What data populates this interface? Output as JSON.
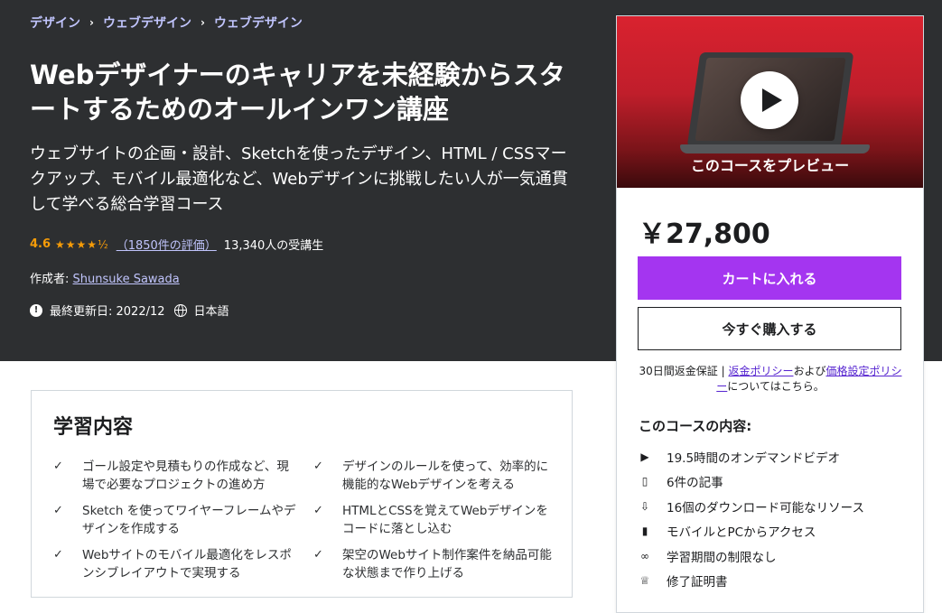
{
  "breadcrumb": [
    "デザイン",
    "ウェブデザイン",
    "ウェブデザイン"
  ],
  "course": {
    "title": "Webデザイナーのキャリアを未経験からスタートするためのオールインワン講座",
    "subtitle": "ウェブサイトの企画・設計、Sketchを使ったデザイン、HTML / CSSマークアップ、モバイル最適化など、Webデザインに挑戦したい人が一気通貫して学べる総合学習コース",
    "rating": "4.6",
    "rating_count": "（1850件の評価）",
    "students": "13,340人の受講生",
    "creator_label": "作成者: ",
    "creator": "Shunsuke Sawada",
    "updated": "最終更新日: 2022/12",
    "language": "日本語"
  },
  "sidebar": {
    "preview_label": "このコースをプレビュー",
    "price": "￥27,800",
    "cart_button": "カートに入れる",
    "buy_button": "今すぐ購入する",
    "guarantee_prefix": "30日間返金保証 | ",
    "refund_policy": "返金ポリシー",
    "and": "および",
    "pricing_policy": "価格設定ポリシー",
    "guarantee_suffix": "についてはこちら。",
    "includes_title": "このコースの内容:",
    "includes": [
      {
        "icon": "video-icon",
        "text": "19.5時間のオンデマンドビデオ"
      },
      {
        "icon": "file-icon",
        "text": "6件の記事"
      },
      {
        "icon": "download-icon",
        "text": "16個のダウンロード可能なリソース"
      },
      {
        "icon": "mobile-icon",
        "text": "モバイルとPCからアクセス"
      },
      {
        "icon": "infinity-icon",
        "text": "学習期間の制限なし"
      },
      {
        "icon": "trophy-icon",
        "text": "修了証明書"
      }
    ]
  },
  "learn": {
    "title": "学習内容",
    "items": [
      "ゴール設定や見積もりの作成など、現場で必要なプロジェクトの進め方",
      "デザインのルールを使って、効率的に機能的なWebデザインを考える",
      "Sketch を使ってワイヤーフレームやデザインを作成する",
      "HTMLとCSSを覚えてWebデザインをコードに落とし込む",
      "Webサイトのモバイル最適化をレスポンシブレイアウトで実現する",
      "架空のWebサイト制作案件を納品可能な状態まで作り上げる"
    ]
  },
  "colors": {
    "hero_bg": "#2d2f31",
    "accent": "#a435f0",
    "link_light": "#c0c4fc",
    "star": "#f69c08"
  }
}
